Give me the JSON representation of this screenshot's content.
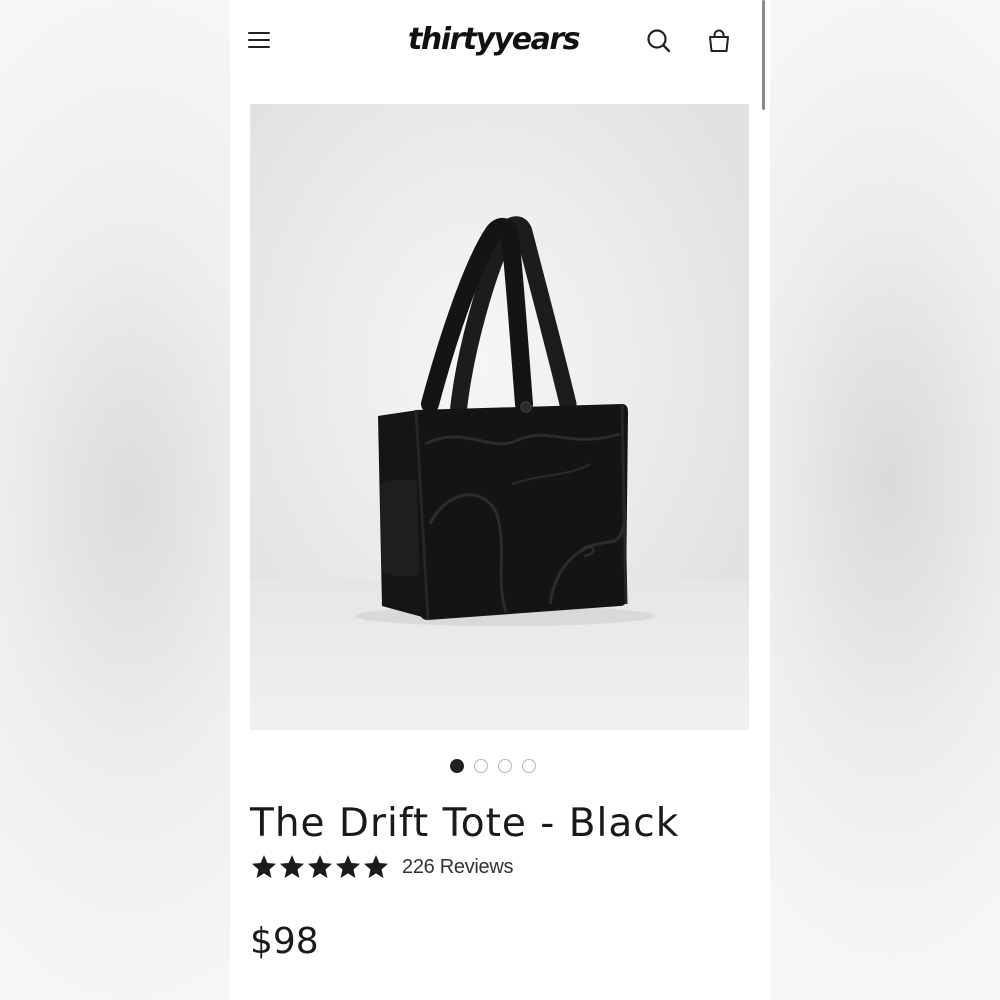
{
  "header": {
    "logo_text": "thirtyyears",
    "menu_icon": "hamburger-menu-icon",
    "search_icon": "search-icon",
    "cart_icon": "shopping-bag-icon"
  },
  "gallery": {
    "image_alt": "The Drift Tote - Black",
    "slide_count": 4,
    "active_slide": 1
  },
  "product": {
    "title": "The Drift Tote - Black",
    "rating": 5,
    "reviews_label": "226 Reviews",
    "price": "$98"
  },
  "colors": {
    "text": "#1a1a1a",
    "bag": "#141414",
    "background": "#ffffff"
  }
}
